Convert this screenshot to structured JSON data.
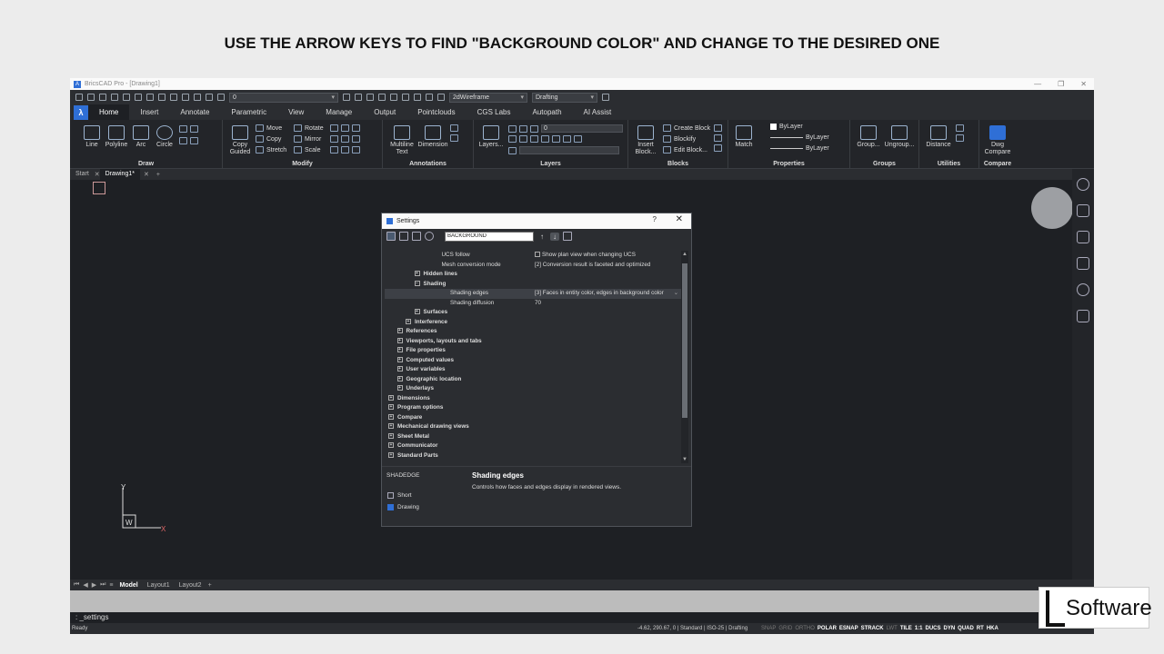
{
  "banner": "USE THE ARROW KEYS TO FIND \"BACKGROUND COLOR\" AND CHANGE TO THE DESIRED ONE",
  "window": {
    "title": "BricsCAD Pro - [Drawing1]"
  },
  "qat": {
    "layer_value": "0",
    "visual_style": "2dWireframe",
    "workspace": "Drafting"
  },
  "ribbon_tabs": [
    "Home",
    "Insert",
    "Annotate",
    "Parametric",
    "View",
    "Manage",
    "Output",
    "Pointclouds",
    "CGS Labs",
    "Autopath",
    "AI Assist"
  ],
  "ribbon": {
    "draw": {
      "label": "Draw",
      "line": "Line",
      "polyline": "Polyline",
      "arc": "Arc",
      "circle": "Circle"
    },
    "modify": {
      "label": "Modify",
      "copy_guided": "Copy Guided",
      "move": "Move",
      "copy": "Copy",
      "stretch": "Stretch",
      "rotate": "Rotate",
      "mirror": "Mirror",
      "scale": "Scale"
    },
    "annotations": {
      "label": "Annotations",
      "multiline_text": "Multiline Text",
      "dimension": "Dimension"
    },
    "layers": {
      "label": "Layers",
      "layers_btn": "Layers...",
      "layer_value": "0"
    },
    "blocks": {
      "label": "Blocks",
      "insert_block": "Insert Block...",
      "create_block": "Create Block",
      "blockify": "Blockify",
      "edit_block": "Edit Block..."
    },
    "properties": {
      "label": "Properties",
      "match": "Match",
      "bylayer1": "ByLayer",
      "bylayer2": "ByLayer",
      "bylayer3": "ByLayer"
    },
    "groups": {
      "label": "Groups",
      "group": "Group...",
      "ungroup": "Ungroup..."
    },
    "utilities": {
      "label": "Utilities",
      "distance": "Distance"
    },
    "compare": {
      "label": "Compare",
      "dwg_compare": "Dwg Compare"
    }
  },
  "doc_tabs": [
    "Start",
    "Drawing1*"
  ],
  "layout_tabs": [
    "Model",
    "Layout1",
    "Layout2"
  ],
  "command_line": ": _settings",
  "status": {
    "ready": "Ready",
    "coords": "-4.62, 290.67, 0",
    "style": "Standard",
    "dimstyle": "ISO-25",
    "workspace": "Drafting",
    "toggles_off1": [
      "SNAP",
      "GRID",
      "ORTHO"
    ],
    "toggles_on1": [
      "POLAR",
      "ESNAP",
      "STRACK"
    ],
    "toggles_off2": [
      "LWT"
    ],
    "toggles_on2": [
      "TILE",
      "1:1",
      "DUCS",
      "DYN",
      "QUAD",
      "RT",
      "HKA"
    ]
  },
  "dialog": {
    "title": "Settings",
    "help": "?",
    "close": "✕",
    "search_value": "BACKGROUND",
    "rows": [
      {
        "indent": 3,
        "label": "UCS follow",
        "value": "Show plan view when changing UCS",
        "checkbox": true
      },
      {
        "indent": 3,
        "label": "Mesh conversion mode",
        "value": "[2] Conversion result is faceted and optimized"
      },
      {
        "indent": 3,
        "expander": "+",
        "label": "Hidden lines",
        "bold": true
      },
      {
        "indent": 3,
        "expander": "−",
        "label": "Shading",
        "bold": true
      },
      {
        "indent": 4,
        "label": "Shading edges",
        "value": "[3] Faces in entity color, edges in background color",
        "selected": true,
        "dropdown": true
      },
      {
        "indent": 4,
        "label": "Shading diffusion",
        "value": "70"
      },
      {
        "indent": 3,
        "expander": "+",
        "label": "Surfaces",
        "bold": true
      },
      {
        "indent": 2,
        "expander": "+",
        "label": "Interference",
        "bold": true
      },
      {
        "indent": 1,
        "expander": "+",
        "label": "References",
        "bold": true
      },
      {
        "indent": 1,
        "expander": "+",
        "label": "Viewports, layouts and tabs",
        "bold": true
      },
      {
        "indent": 1,
        "expander": "+",
        "label": "File properties",
        "bold": true
      },
      {
        "indent": 1,
        "expander": "+",
        "label": "Computed values",
        "bold": true
      },
      {
        "indent": 1,
        "expander": "+",
        "label": "User variables",
        "bold": true
      },
      {
        "indent": 1,
        "expander": "+",
        "label": "Geographic location",
        "bold": true
      },
      {
        "indent": 1,
        "expander": "+",
        "label": "Underlays",
        "bold": true
      },
      {
        "indent": 0,
        "expander": "+",
        "label": "Dimensions",
        "bold": true
      },
      {
        "indent": 0,
        "expander": "+",
        "label": "Program options",
        "bold": true
      },
      {
        "indent": 0,
        "expander": "+",
        "label": "Compare",
        "bold": true
      },
      {
        "indent": 0,
        "expander": "+",
        "label": "Mechanical drawing views",
        "bold": true
      },
      {
        "indent": 0,
        "expander": "+",
        "label": "Sheet Metal",
        "bold": true
      },
      {
        "indent": 0,
        "expander": "+",
        "label": "Communicator",
        "bold": true
      },
      {
        "indent": 0,
        "expander": "+",
        "label": "Standard Parts",
        "bold": true
      }
    ],
    "description": {
      "variable": "SHADEDGE",
      "title": "Shading edges",
      "text": "Controls how faces and edges display in rendered views.",
      "type": "Short",
      "scope": "Drawing"
    }
  },
  "ucs_labels": {
    "y": "Y",
    "x": "X",
    "w": "W"
  },
  "watermark": {
    "brand": "Software"
  }
}
